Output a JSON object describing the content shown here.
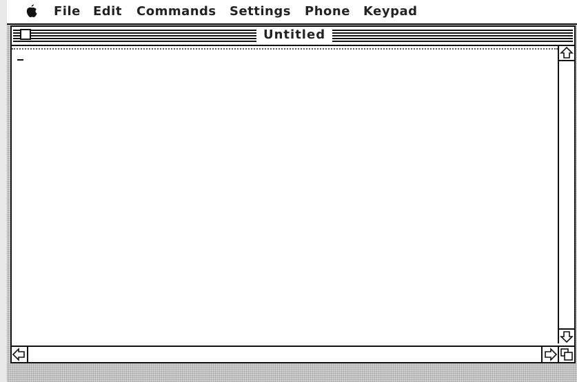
{
  "menubar": {
    "apple_icon": "apple-icon",
    "items": [
      "File",
      "Edit",
      "Commands",
      "Settings",
      "Phone",
      "Keypad"
    ]
  },
  "window": {
    "title": "Untitled"
  },
  "colors": {
    "window_bg": "#ffffff",
    "frame": "#111111",
    "desktop": "#cfcfcf"
  }
}
